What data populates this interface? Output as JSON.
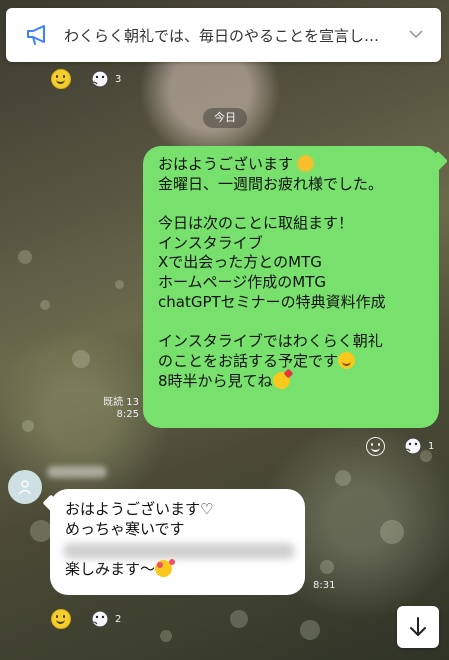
{
  "announcement": {
    "text": "わくらく朝礼では、毎日のやることを宣言し…",
    "icon": "megaphone-icon",
    "expand_icon": "chevron-down-icon"
  },
  "top_reactions": {
    "count": "3"
  },
  "date_label": "今日",
  "outgoing_message": {
    "lines": [
      "おはようございます",
      "金曜日、一週間お疲れ様でした。",
      "",
      "今日は次のことに取組ます！",
      "インスタライブ",
      "Xで出会った方とのMTG",
      "ホームページ作成のMTG",
      "chatGPTセミナーの特典資料作成",
      "",
      "インスタライブではわくらく朝礼",
      "のことをお話する予定です",
      "8時半から見てね"
    ],
    "read_label": "既読 13",
    "time": "8:25",
    "reaction_count": "1"
  },
  "incoming_message": {
    "line1": "おはようございます♡",
    "line2": "めっちゃ寒いです",
    "line4": "楽しみます〜",
    "time": "8:31",
    "reaction_count": "2"
  },
  "colors": {
    "outgoing_bubble": "#78e16e",
    "incoming_bubble": "#ffffff",
    "announcement_icon": "#3b82f6"
  }
}
